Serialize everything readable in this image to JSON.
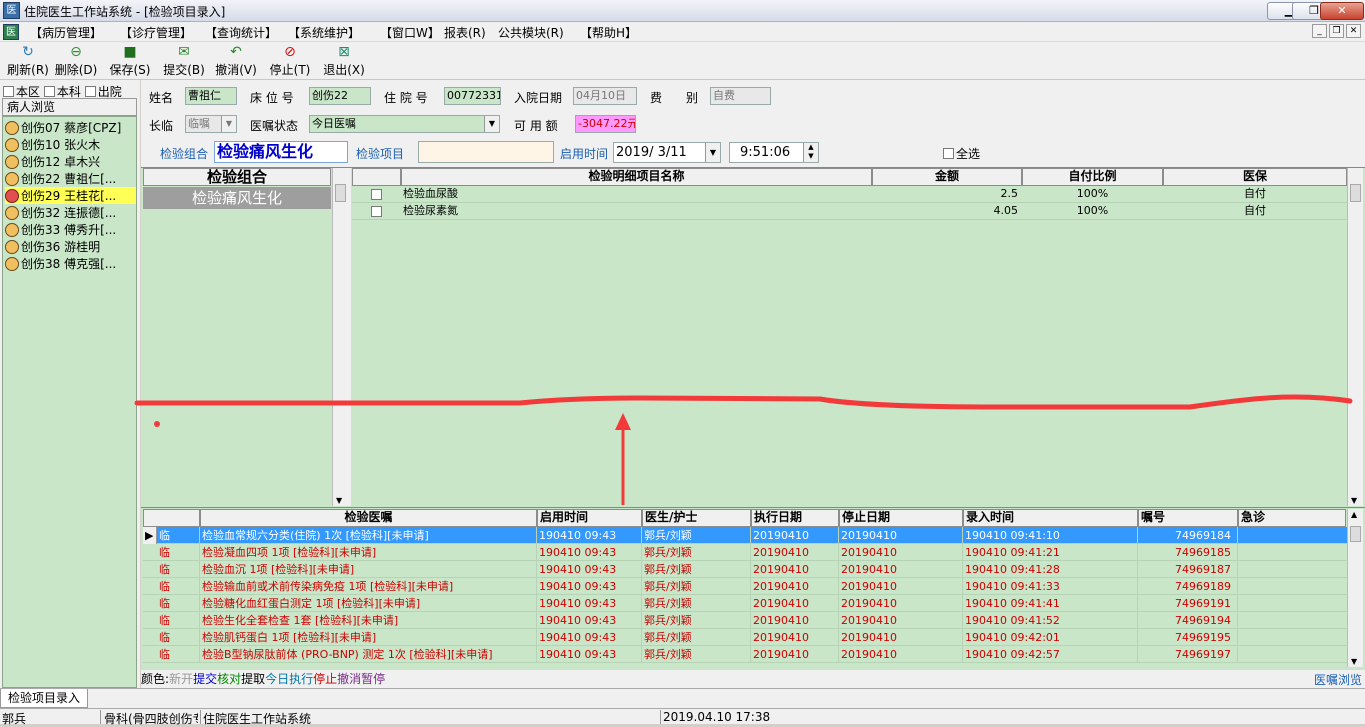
{
  "window": {
    "title": "住院医生工作站系统 - [检验项目录入]"
  },
  "menu": [
    "【病历管理】",
    "【诊疗管理】",
    "【查询统计】",
    "【系统维护】",
    "【窗口W】",
    "报表(R)",
    "公共模块(R)",
    "【帮助H】"
  ],
  "toolbar": [
    {
      "label": "刷新(R)",
      "icon": "refresh-icon",
      "color": "#2a7ab8",
      "glyph": "↻"
    },
    {
      "label": "删除(D)",
      "icon": "delete-icon",
      "color": "#2f8f2f",
      "glyph": "⊖"
    },
    {
      "label": "保存(S)",
      "icon": "save-icon",
      "color": "#1f6f1f",
      "glyph": "■"
    },
    {
      "label": "提交(B)",
      "icon": "submit-icon",
      "color": "#2a8a2a",
      "glyph": "✉"
    },
    {
      "label": "撤消(V)",
      "icon": "undo-icon",
      "color": "#2a8a2a",
      "glyph": "↶"
    },
    {
      "label": "停止(T)",
      "icon": "stop-icon",
      "color": "#d01010",
      "glyph": "⊘"
    },
    {
      "label": "退出(X)",
      "icon": "exit-icon",
      "color": "#1f8f6f",
      "glyph": "⊠"
    }
  ],
  "filters": [
    "本区",
    "本科",
    "出院"
  ],
  "patient_list": {
    "header": "病人浏览",
    "items": [
      {
        "bed": "创伤07",
        "name": "蔡彦[CPZ]",
        "sel": false
      },
      {
        "bed": "创伤10",
        "name": "张火木",
        "sel": false
      },
      {
        "bed": "创伤12",
        "name": "卓木兴",
        "sel": false
      },
      {
        "bed": "创伤22",
        "name": "曹祖仁[...",
        "sel": false
      },
      {
        "bed": "创伤29",
        "name": "王桂花[...",
        "sel": true
      },
      {
        "bed": "创伤32",
        "name": "连振德[...",
        "sel": false
      },
      {
        "bed": "创伤33",
        "name": "傅秀升[...",
        "sel": false
      },
      {
        "bed": "创伤36",
        "name": "游桂明",
        "sel": false
      },
      {
        "bed": "创伤38",
        "name": "傅克强[...",
        "sel": false
      }
    ]
  },
  "form": {
    "name_label": "姓名",
    "name_value": "曹祖仁",
    "bed_label": "床 位 号",
    "bed_value": "创伤22",
    "admit_no_label": "住 院 号",
    "admit_no_value": "00772331",
    "admit_date_label": "入院日期",
    "admit_date_value": "04月10日",
    "fee_label": "费",
    "fee_label2": "别",
    "fee_value": "自费",
    "long_label": "长临",
    "long_value": "临嘱",
    "order_status_label": "医嘱状态",
    "order_status_value": "今日医嘱",
    "available_label": "可 用 额",
    "available_value": "-3047.22元",
    "group_label": "检验组合",
    "group_value": "检验痛风生化",
    "item_label": "检验项目",
    "item_value": "",
    "start_time_label": "启用时间",
    "start_date": "2019/ 3/11",
    "start_time": "9:51:06",
    "select_all": "全选"
  },
  "group_list": {
    "header": "检验组合",
    "items": [
      "检验痛风生化"
    ]
  },
  "detail_table": {
    "columns": [
      "检验明细项目名称",
      "金额",
      "自付比例",
      "医保"
    ],
    "rows": [
      {
        "name": "检验血尿酸",
        "amount": "2.5",
        "ratio": "100%",
        "insurance": "自付"
      },
      {
        "name": "检验尿素氮",
        "amount": "4.05",
        "ratio": "100%",
        "insurance": "自付"
      }
    ]
  },
  "orders_table": {
    "columns": [
      "检验医嘱",
      "启用时间",
      "医生/护士",
      "执行日期",
      "停止日期",
      "录入时间",
      "嘱号",
      "急诊"
    ],
    "rows": [
      {
        "type": "临",
        "order": "检验血常规六分类(住院)  1次 [检验科][未申请]",
        "start": "190410 09:43",
        "doctor": "郭兵/刘颖",
        "exec": "20190410",
        "stop": "20190410",
        "entry": "190410 09:41:10",
        "no": "74969184",
        "urgent": "",
        "sel": true
      },
      {
        "type": "临",
        "order": "检验凝血四项  1项 [检验科][未申请]",
        "start": "190410 09:43",
        "doctor": "郭兵/刘颖",
        "exec": "20190410",
        "stop": "20190410",
        "entry": "190410 09:41:21",
        "no": "74969185",
        "urgent": "",
        "sel": false
      },
      {
        "type": "临",
        "order": "检验血沉  1项 [检验科][未申请]",
        "start": "190410 09:43",
        "doctor": "郭兵/刘颖",
        "exec": "20190410",
        "stop": "20190410",
        "entry": "190410 09:41:28",
        "no": "74969187",
        "urgent": "",
        "sel": false
      },
      {
        "type": "临",
        "order": "检验输血前或术前传染病免疫  1项 [检验科][未申请]",
        "start": "190410 09:43",
        "doctor": "郭兵/刘颖",
        "exec": "20190410",
        "stop": "20190410",
        "entry": "190410 09:41:33",
        "no": "74969189",
        "urgent": "",
        "sel": false
      },
      {
        "type": "临",
        "order": "检验糖化血红蛋白测定  1项 [检验科][未申请]",
        "start": "190410 09:43",
        "doctor": "郭兵/刘颖",
        "exec": "20190410",
        "stop": "20190410",
        "entry": "190410 09:41:41",
        "no": "74969191",
        "urgent": "",
        "sel": false
      },
      {
        "type": "临",
        "order": "检验生化全套检查  1套 [检验科][未申请]",
        "start": "190410 09:43",
        "doctor": "郭兵/刘颖",
        "exec": "20190410",
        "stop": "20190410",
        "entry": "190410 09:41:52",
        "no": "74969194",
        "urgent": "",
        "sel": false
      },
      {
        "type": "临",
        "order": "检验肌钙蛋白  1项 [检验科][未申请]",
        "start": "190410 09:43",
        "doctor": "郭兵/刘颖",
        "exec": "20190410",
        "stop": "20190410",
        "entry": "190410 09:42:01",
        "no": "74969195",
        "urgent": "",
        "sel": false
      },
      {
        "type": "临",
        "order": "检验B型钠尿肽前体 (PRO-BNP) 测定  1次 [检验科][未申请]",
        "start": "190410 09:43",
        "doctor": "郭兵/刘颖",
        "exec": "20190410",
        "stop": "20190410",
        "entry": "190410 09:42:57",
        "no": "74969197",
        "urgent": "",
        "sel": false
      }
    ]
  },
  "legend": {
    "prefix": "颜色:",
    "items": [
      {
        "text": "新开",
        "color": "#999999"
      },
      {
        "text": "提交",
        "color": "#0000cc"
      },
      {
        "text": "核对",
        "color": "#008800"
      },
      {
        "text": "提取",
        "color": "#000000"
      },
      {
        "text": "今日执行",
        "color": "#0077aa"
      },
      {
        "text": "停止",
        "color": "#cc0000"
      },
      {
        "text": "撤消",
        "color": "#7a2a8a"
      },
      {
        "text": "暂停",
        "color": "#7a2a8a"
      }
    ],
    "right": "医嘱浏览"
  },
  "tab": "检验项目录入",
  "status": {
    "user": "郭兵",
    "dept": "骨科(骨四肢创伤专",
    "system": "住院医生工作站系统",
    "datetime": "2019.04.10 17:38"
  }
}
